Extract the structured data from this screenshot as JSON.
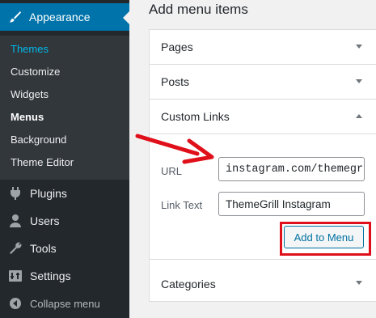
{
  "sidebar": {
    "appearance_label": "Appearance",
    "submenu": [
      "Themes",
      "Customize",
      "Widgets",
      "Menus",
      "Background",
      "Theme Editor"
    ],
    "items": [
      {
        "label": "Plugins",
        "icon": "plugin-icon"
      },
      {
        "label": "Users",
        "icon": "users-icon"
      },
      {
        "label": "Tools",
        "icon": "tools-icon"
      },
      {
        "label": "Settings",
        "icon": "settings-icon"
      }
    ],
    "collapse_label": "Collapse menu"
  },
  "main": {
    "title": "Add menu items",
    "sections": {
      "pages": "Pages",
      "posts": "Posts",
      "custom_links": "Custom Links",
      "categories": "Categories"
    },
    "custom_links": {
      "url_label": "URL",
      "url_value": "instagram.com/themegrill",
      "link_text_label": "Link Text",
      "link_text_value": "ThemeGrill Instagram",
      "add_button": "Add to Menu"
    }
  },
  "colors": {
    "sidebar_bg": "#23282d",
    "submenu_bg": "#32373c",
    "accent": "#0073aa",
    "highlight_red": "#e0101a"
  }
}
